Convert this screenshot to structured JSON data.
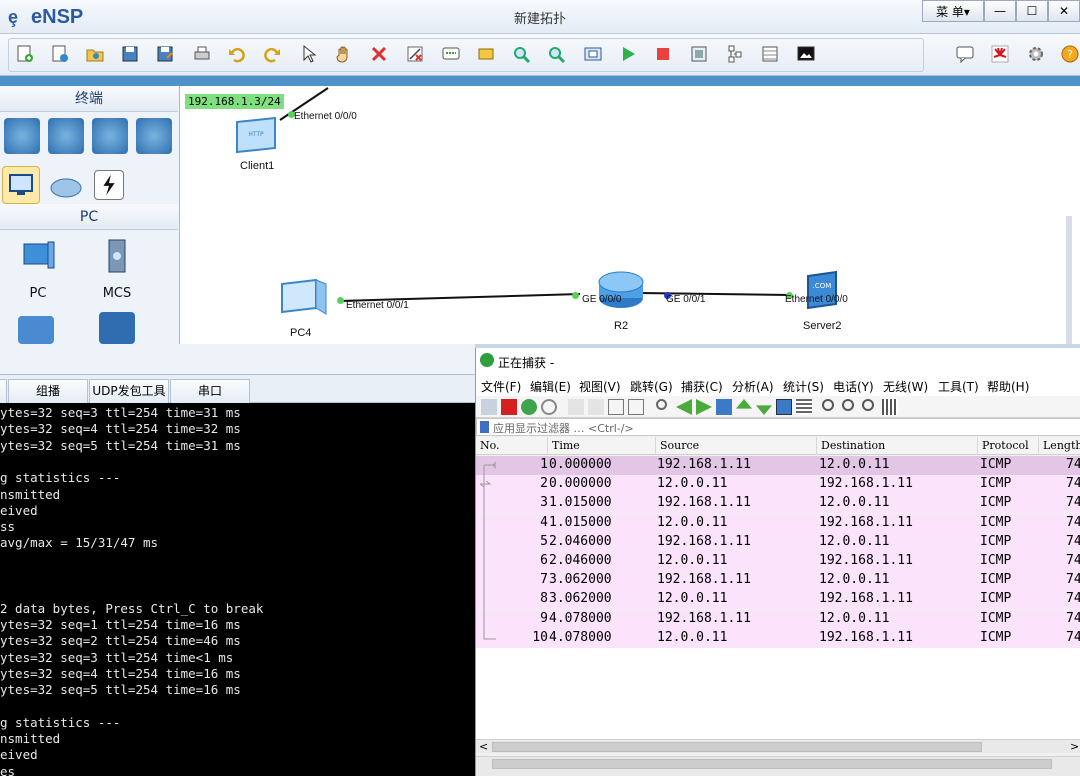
{
  "app": {
    "logo_text": "eNSP",
    "window_title": "新建拓扑",
    "menu_label": "菜 单▾",
    "minimize": "—",
    "maximize": "☐",
    "close": "✕"
  },
  "device_panel": {
    "section_terminal": "终端",
    "section_pc": "PC",
    "devices": [
      {
        "label": "PC"
      },
      {
        "label": "MCS"
      }
    ]
  },
  "topology": {
    "ip_label": "192.168.1.3/24",
    "client1": {
      "label": "Client1",
      "port": "Ethernet 0/0/0"
    },
    "pc4": {
      "label": "PC4",
      "port": "Ethernet 0/0/1"
    },
    "r2": {
      "label": "R2",
      "port_left": "GE 0/0/0",
      "port_right": "GE 0/0/1"
    },
    "server2": {
      "label": "Server2",
      "port": "Ethernet 0/0/0"
    }
  },
  "cli": {
    "tabs": [
      "组播",
      "UDP发包工具",
      "串口"
    ],
    "lines": [
      "ytes=32 seq=3 ttl=254 time=31 ms",
      "ytes=32 seq=4 ttl=254 time=32 ms",
      "ytes=32 seq=5 ttl=254 time=31 ms",
      "",
      "g statistics ---",
      "nsmitted",
      "eived",
      "ss",
      "avg/max = 15/31/47 ms",
      "",
      "",
      "",
      "2 data bytes, Press Ctrl_C to break",
      "ytes=32 seq=1 ttl=254 time=16 ms",
      "ytes=32 seq=2 ttl=254 time=46 ms",
      "ytes=32 seq=3 ttl=254 time<1 ms",
      "ytes=32 seq=4 ttl=254 time=16 ms",
      "ytes=32 seq=5 ttl=254 time=16 ms",
      "",
      "g statistics ---",
      "nsmitted",
      "eived",
      "es"
    ]
  },
  "wireshark": {
    "title": "正在捕获 -",
    "menu": [
      "文件(F)",
      "编辑(E)",
      "视图(V)",
      "跳转(G)",
      "捕获(C)",
      "分析(A)",
      "统计(S)",
      "电话(Y)",
      "无线(W)",
      "工具(T)",
      "帮助(H)"
    ],
    "filter_placeholder": "应用显示过滤器 … <Ctrl-/>",
    "columns": [
      "No.",
      "Time",
      "Source",
      "Destination",
      "Protocol",
      "Length"
    ],
    "packets": [
      {
        "no": "1",
        "time": "0.000000",
        "src": "192.168.1.11",
        "dst": "12.0.0.11",
        "proto": "ICMP",
        "len": "74"
      },
      {
        "no": "2",
        "time": "0.000000",
        "src": "12.0.0.11",
        "dst": "192.168.1.11",
        "proto": "ICMP",
        "len": "74"
      },
      {
        "no": "3",
        "time": "1.015000",
        "src": "192.168.1.11",
        "dst": "12.0.0.11",
        "proto": "ICMP",
        "len": "74"
      },
      {
        "no": "4",
        "time": "1.015000",
        "src": "12.0.0.11",
        "dst": "192.168.1.11",
        "proto": "ICMP",
        "len": "74"
      },
      {
        "no": "5",
        "time": "2.046000",
        "src": "192.168.1.11",
        "dst": "12.0.0.11",
        "proto": "ICMP",
        "len": "74"
      },
      {
        "no": "6",
        "time": "2.046000",
        "src": "12.0.0.11",
        "dst": "192.168.1.11",
        "proto": "ICMP",
        "len": "74"
      },
      {
        "no": "7",
        "time": "3.062000",
        "src": "192.168.1.11",
        "dst": "12.0.0.11",
        "proto": "ICMP",
        "len": "74"
      },
      {
        "no": "8",
        "time": "3.062000",
        "src": "12.0.0.11",
        "dst": "192.168.1.11",
        "proto": "ICMP",
        "len": "74"
      },
      {
        "no": "9",
        "time": "4.078000",
        "src": "192.168.1.11",
        "dst": "12.0.0.11",
        "proto": "ICMP",
        "len": "74"
      },
      {
        "no": "10",
        "time": "4.078000",
        "src": "12.0.0.11",
        "dst": "192.168.1.11",
        "proto": "ICMP",
        "len": "74"
      }
    ],
    "scroll_left": "<",
    "scroll_right": ">"
  }
}
